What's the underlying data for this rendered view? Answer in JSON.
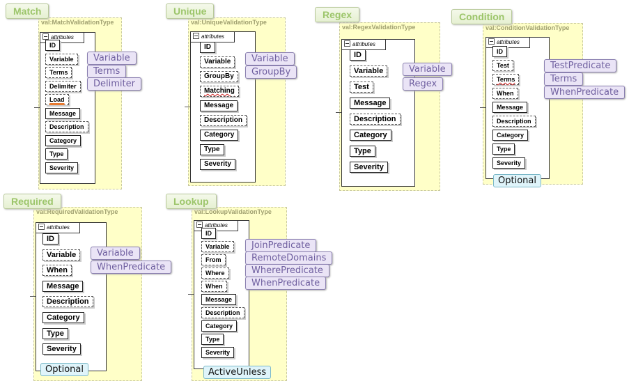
{
  "panels": [
    {
      "id": "match",
      "label": "Match",
      "type_name": "val:MatchValidationType",
      "attributes_label": "attributes",
      "items": [
        {
          "name": "ID"
        },
        {
          "name": "Variable",
          "optional": true
        },
        {
          "name": "Terms",
          "optional": true
        },
        {
          "name": "Delimiter",
          "optional": true
        },
        {
          "name": "Load",
          "optional": true,
          "mark": "orange"
        },
        {
          "name": "Message"
        },
        {
          "name": "Description",
          "optional": true
        },
        {
          "name": "Category"
        },
        {
          "name": "Type"
        },
        {
          "name": "Severity"
        }
      ],
      "notes": [
        "Variable",
        "Terms",
        "Delimiter"
      ]
    },
    {
      "id": "unique",
      "label": "Unique",
      "type_name": "val:UniqueValidationType",
      "attributes_label": "attributes",
      "items": [
        {
          "name": "ID"
        },
        {
          "name": "Variable",
          "optional": true
        },
        {
          "name": "GroupBy",
          "optional": true
        },
        {
          "name": "Matching",
          "optional": true,
          "mark": "red"
        },
        {
          "name": "Message"
        },
        {
          "name": "Description",
          "optional": true
        },
        {
          "name": "Category"
        },
        {
          "name": "Type"
        },
        {
          "name": "Severity"
        }
      ],
      "notes": [
        "Variable",
        "GroupBy"
      ]
    },
    {
      "id": "regex",
      "label": "Regex",
      "type_name": "val:RegexValidationType",
      "attributes_label": "attributes",
      "items": [
        {
          "name": "ID"
        },
        {
          "name": "Variable",
          "optional": true
        },
        {
          "name": "Test",
          "optional": true
        },
        {
          "name": "Message"
        },
        {
          "name": "Description",
          "optional": true
        },
        {
          "name": "Category"
        },
        {
          "name": "Type"
        },
        {
          "name": "Severity"
        }
      ],
      "notes": [
        "Variable",
        "Regex"
      ]
    },
    {
      "id": "condition",
      "label": "Condition",
      "type_name": "val:ConditionValidationType",
      "attributes_label": "attributes",
      "items": [
        {
          "name": "ID"
        },
        {
          "name": "Test",
          "optional": true
        },
        {
          "name": "Terms",
          "optional": true,
          "mark": "red"
        },
        {
          "name": "When",
          "optional": true
        },
        {
          "name": "Message"
        },
        {
          "name": "Description",
          "optional": true
        },
        {
          "name": "Category"
        },
        {
          "name": "Type"
        },
        {
          "name": "Severity"
        }
      ],
      "notes": [
        "TestPredicate",
        "Terms",
        "WhenPredicate"
      ],
      "footer": "Optional"
    },
    {
      "id": "required",
      "label": "Required",
      "type_name": "val:RequiredValidationType",
      "attributes_label": "attributes",
      "items": [
        {
          "name": "ID"
        },
        {
          "name": "Variable",
          "optional": true
        },
        {
          "name": "When",
          "optional": true
        },
        {
          "name": "Message"
        },
        {
          "name": "Description",
          "optional": true
        },
        {
          "name": "Category"
        },
        {
          "name": "Type"
        },
        {
          "name": "Severity"
        }
      ],
      "notes": [
        "Variable",
        "WhenPredicate"
      ],
      "footer": "Optional"
    },
    {
      "id": "lookup",
      "label": "Lookup",
      "type_name": "val:LookupValidationType",
      "attributes_label": "attributes",
      "items": [
        {
          "name": "ID"
        },
        {
          "name": "Variable",
          "optional": true
        },
        {
          "name": "From",
          "optional": true
        },
        {
          "name": "Where",
          "optional": true
        },
        {
          "name": "When",
          "optional": true
        },
        {
          "name": "Message"
        },
        {
          "name": "Description",
          "optional": true
        },
        {
          "name": "Category"
        },
        {
          "name": "Type"
        },
        {
          "name": "Severity"
        }
      ],
      "notes": [
        "JoinPredicate",
        "RemoteDomains",
        "WherePredicate",
        "WhenPredicate"
      ],
      "footer": "ActiveUnless"
    }
  ]
}
